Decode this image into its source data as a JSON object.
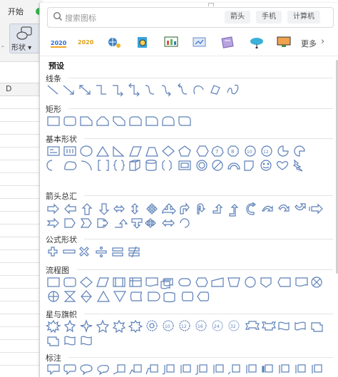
{
  "ribbon": {
    "start_tab": "开始",
    "shape_button": "形状"
  },
  "sheet": {
    "column_header": "D"
  },
  "panel": {
    "search_placeholder": "搜索图标",
    "tags": [
      "箭头",
      "手机",
      "计算机"
    ],
    "more": "更多",
    "preset_label": "预设",
    "categories": [
      "线条",
      "矩形",
      "基本形状",
      "箭头总汇",
      "公式形状",
      "流程图",
      "星与旗帜",
      "标注"
    ],
    "numbered_shape_labels": [
      "7",
      "8",
      "10",
      "12",
      "4",
      "6",
      "8",
      "10",
      "12",
      "16",
      "24",
      "32"
    ]
  },
  "colors": {
    "shape_stroke": "#5b7fb8",
    "accent_green": "#37b24d"
  }
}
